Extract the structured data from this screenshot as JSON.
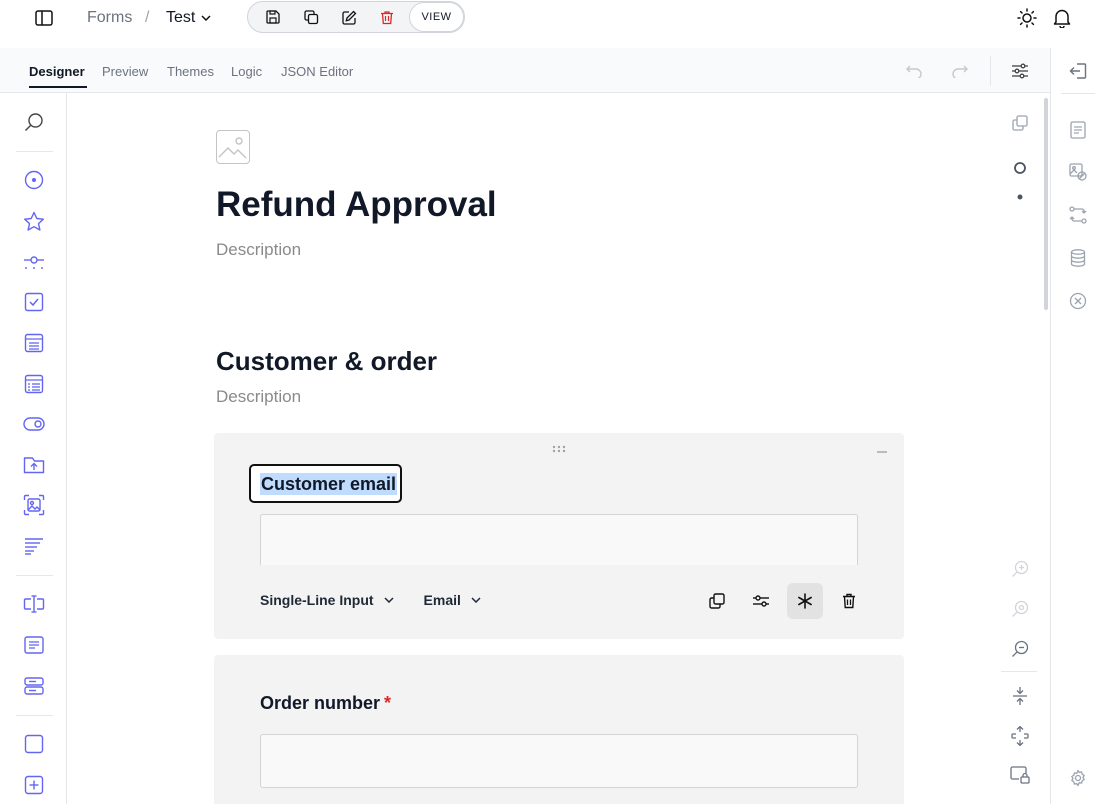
{
  "breadcrumb": {
    "root": "Forms",
    "separator": "/",
    "current": "Test"
  },
  "toolbar": {
    "view_label": "VIEW"
  },
  "tabs": [
    {
      "label": "Designer",
      "active": true
    },
    {
      "label": "Preview",
      "active": false
    },
    {
      "label": "Themes",
      "active": false
    },
    {
      "label": "Logic",
      "active": false
    },
    {
      "label": "JSON Editor",
      "active": false
    }
  ],
  "survey": {
    "title": "Refund Approval",
    "description": "Description",
    "page": {
      "title": "Customer & order",
      "description": "Description"
    },
    "questions": [
      {
        "title": "Customer email",
        "type_label": "Single-Line Input",
        "input_type_label": "Email",
        "required": false,
        "selected": true
      },
      {
        "title": "Order number",
        "required_mark": "*",
        "required": true
      }
    ]
  },
  "colors": {
    "accent": "#6366f1",
    "danger": "#dc2626",
    "selection": "#bfdbfe"
  },
  "icons": {
    "toolbox": [
      "search-icon",
      "radiogroup-icon",
      "rating-icon",
      "slider-icon",
      "checkbox-icon",
      "dropdown-icon",
      "multi-select-dropdown-icon",
      "boolean-toggle-icon",
      "file-upload-icon",
      "image-picker-icon",
      "ranking-icon",
      "single-line-input-icon",
      "long-text-icon",
      "multiple-textboxes-icon",
      "panel-icon",
      "dynamic-panel-icon"
    ],
    "right_panel": [
      "collapse-panel-icon",
      "general-settings-icon",
      "logo-settings-icon",
      "navigation-icon",
      "data-icon",
      "validation-icon",
      "settings-gear-icon"
    ]
  }
}
